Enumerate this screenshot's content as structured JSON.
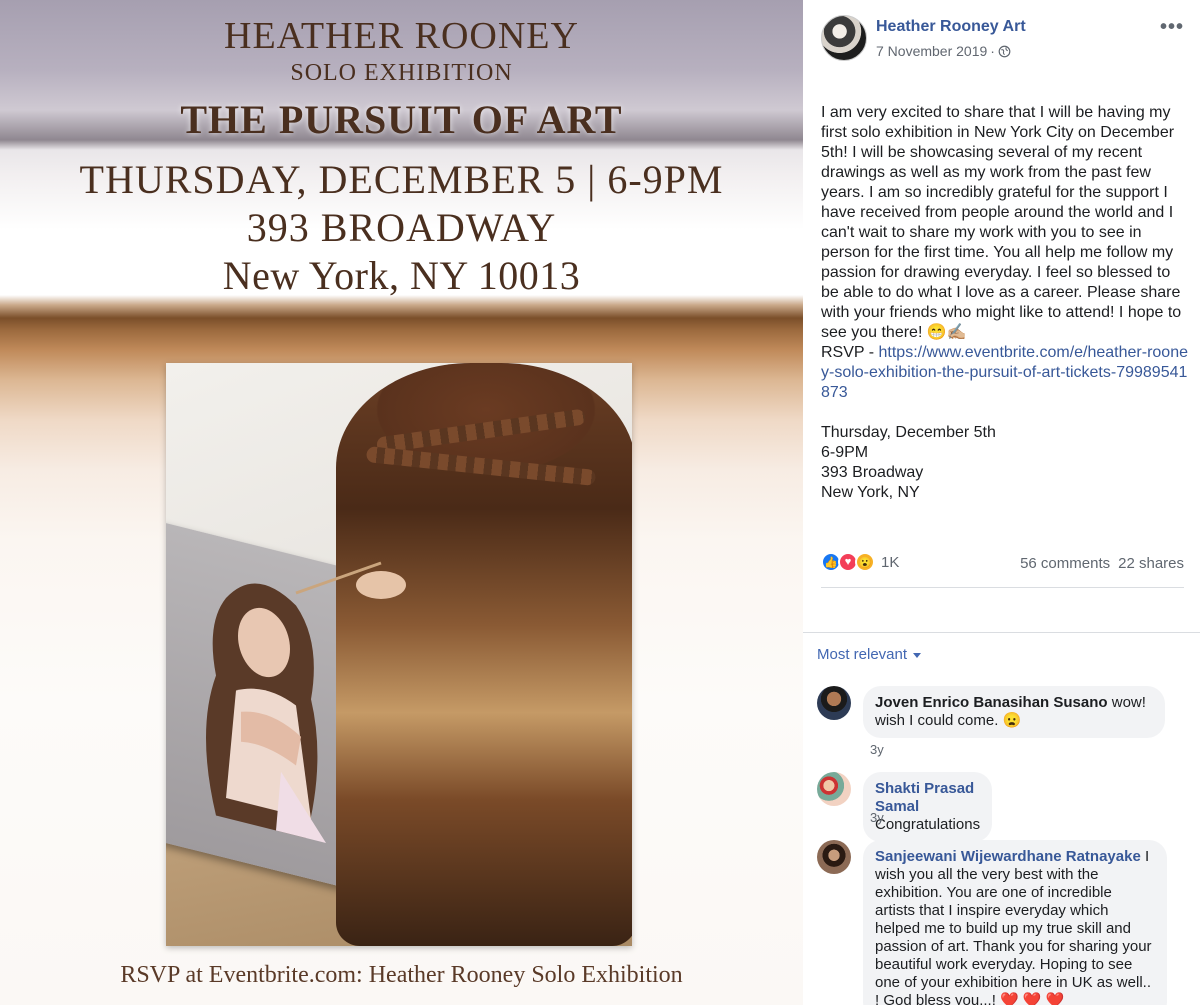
{
  "poster": {
    "name": "HEATHER ROONEY",
    "subtitle": "SOLO EXHIBITION",
    "title": "THE PURSUIT OF ART",
    "date_time": "THURSDAY, DECEMBER 5 | 6-9PM",
    "address": "393 BROADWAY",
    "city": "New York, NY 10013",
    "rsvp": "RSVP at Eventbrite.com: Heather Rooney Solo Exhibition"
  },
  "post": {
    "page_name": "Heather Rooney Art",
    "date": "7 November 2019",
    "separator": "·",
    "more_label": "•••",
    "body": "I am very excited to share that I will be having my first solo exhibition in New York City on December 5th! I will be showcasing several of my recent drawings as well as my work from the past few years. I am so incredibly grateful for the support I have received from people around the world and I can't wait to share my work with you to see in person for the first time. You all help me follow my passion for drawing everyday. I feel so blessed to be able to do what I love as a career. Please share with your friends who might like to attend! I hope to see you there! 😁✍🏼",
    "rsvp_prefix": "RSVP - ",
    "rsvp_link": "https://www.eventbrite.com/e/heather-rooney-solo-exhibition-the-pursuit-of-art-tickets-79989541873",
    "event_lines": [
      "Thursday, December 5th",
      "6-9PM",
      "393 Broadway",
      "New York, NY"
    ],
    "reaction_count": "1K",
    "comments_count": "56 comments",
    "shares_count": "22 shares"
  },
  "comments_section": {
    "sort_label": "Most relevant",
    "comments": [
      {
        "author": "Joven Enrico Banasihan Susano",
        "text": "wow! wish I could come. 😦",
        "time": "3y"
      },
      {
        "author": "Shakti Prasad Samal",
        "text": "Congratulations",
        "time": "3y"
      },
      {
        "author": "Sanjeewani Wijewardhane Ratnayake",
        "text": "I wish you all the very best with the exhibition. You are one of incredible artists that I inspire everyday which helped me to build up my true skill and passion of art. Thank you for sharing your beautiful work everyday. Hoping to see one of your exhibition here in UK as well.. ! God bless you...! ❤️ ❤️ ❤️",
        "time": ""
      }
    ]
  },
  "colors": {
    "link": "#385898",
    "meta": "#616770",
    "poster_text": "#4a2f1f",
    "bubble": "#f2f3f5"
  },
  "icons": {
    "globe": "globe-icon",
    "more": "more-options-icon",
    "like": "like-reaction-icon",
    "love": "love-reaction-icon",
    "wow": "wow-reaction-icon",
    "caret": "caret-down-icon"
  }
}
